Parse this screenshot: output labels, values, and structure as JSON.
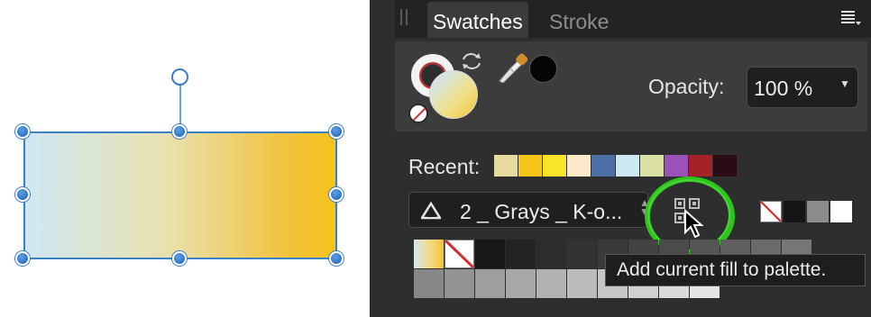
{
  "tabs": {
    "active": "Swatches",
    "inactive": "Stroke"
  },
  "opacity": {
    "label": "Opacity:",
    "value": "100 %"
  },
  "recent": {
    "label": "Recent:",
    "colors": [
      "#e7dba0",
      "#f5c518",
      "#f9e42a",
      "#fbe9c8",
      "#4e6ea8",
      "#cfe8f5",
      "#dbe0a3",
      "#9a52b8",
      "#a32326",
      "#2b0b14"
    ]
  },
  "palette": {
    "name": "2 _ Grays _ K-o..."
  },
  "tooltip": {
    "text": "Add current fill to palette."
  },
  "mini_swatches": [
    "none",
    "#151515",
    "#8b8b8b",
    "#ffffff"
  ],
  "grid_colors": [
    "gradient",
    "none",
    "#171717",
    "#232323",
    "#2c2c2c",
    "#323232",
    "#3a3a3a",
    "#434343",
    "#4b4b4b",
    "#555555",
    "#5f5f5f",
    "#6a6a6a",
    "#767676",
    "#878787",
    "#939393",
    "#9e9e9e",
    "#a8a8a8",
    "#b2b2b2",
    "#bcbcbc",
    "#c6c6c6",
    "#d0d0d0",
    "#dadada",
    "#e4e4e4"
  ],
  "colors": {
    "selection_handle": "#2f7fd3",
    "highlight_circle": "#2ec41d",
    "panel_bg": "#2e2e2e"
  }
}
